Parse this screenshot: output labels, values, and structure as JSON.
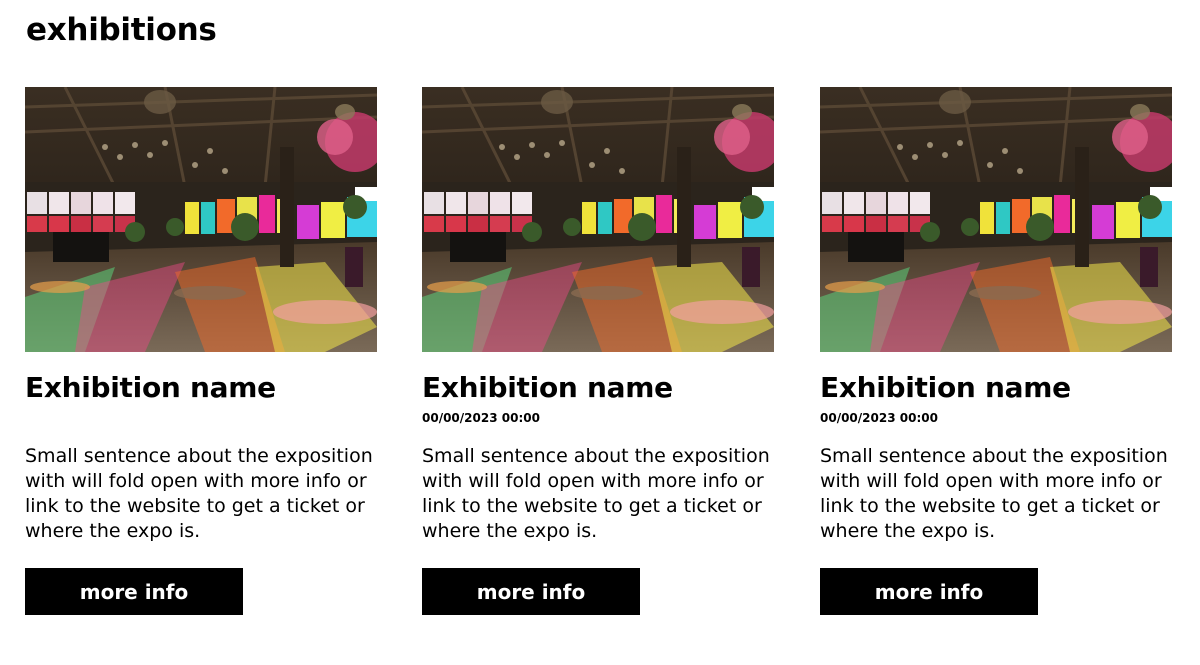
{
  "header": {
    "title": "exhibitions"
  },
  "exhibitions": [
    {
      "name": "Exhibition name",
      "date": "",
      "description": "Small sentence about the exposition with will fold open with more info or link to the website to get a ticket or where the expo is.",
      "button_label": "more info",
      "image_alt": "colorful-venue-hall-photo"
    },
    {
      "name": "Exhibition name",
      "date": "00/00/2023 00:00",
      "description": "Small sentence about the exposition with will fold open with more info or link to the website to get a ticket or where the expo is.",
      "button_label": "more info",
      "image_alt": "colorful-venue-hall-photo"
    },
    {
      "name": "Exhibition name",
      "date": "00/00/2023 00:00",
      "description": "Small sentence about the exposition with will fold open with more info or link to the website to get a ticket or where the expo is.",
      "button_label": "more info",
      "image_alt": "colorful-venue-hall-photo"
    }
  ],
  "colors": {
    "text": "#000000",
    "button_bg": "#000000",
    "button_text": "#ffffff",
    "background": "#ffffff"
  }
}
